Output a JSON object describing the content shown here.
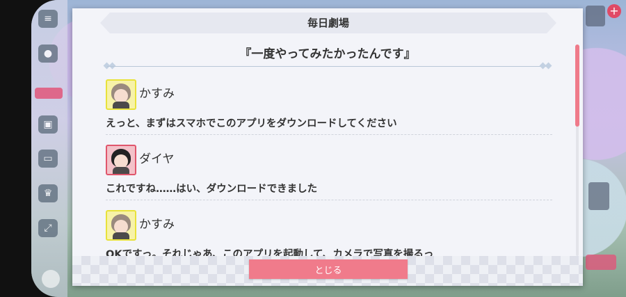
{
  "dialog": {
    "title": "毎日劇場",
    "story_title": "『一度やってみたかったんです』",
    "close_label": "とじる"
  },
  "entries": [
    {
      "speaker": "かすみ",
      "avatar_color": "#e8e23a",
      "text": "えっと、まずはスマホでこのアプリをダウンロードしてください"
    },
    {
      "speaker": "ダイヤ",
      "avatar_color": "#e0566c",
      "text": "これですね……はい、ダウンロードできました"
    },
    {
      "speaker": "かすみ",
      "avatar_color": "#e8e23a",
      "text": "OKですっ。それじゃあ、このアプリを起動して、カメラで写真を撮るっ"
    }
  ],
  "colors": {
    "accent_pink": "#f07b8b",
    "dialog_bg": "#f3f4f9"
  },
  "icons": [
    "menu-icon",
    "chat-icon",
    "gift-icon",
    "monitor-icon",
    "trophy-icon",
    "expand-icon",
    "plus-icon"
  ]
}
